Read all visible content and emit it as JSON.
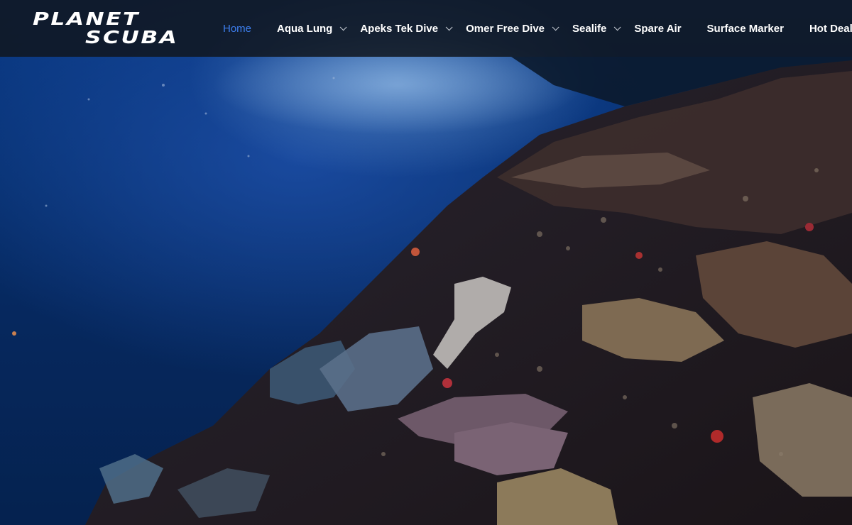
{
  "site": {
    "logo_line1": "PLANET",
    "logo_line2": "SCUBA"
  },
  "nav": {
    "items": [
      {
        "label": "Home",
        "active": true,
        "has_submenu": false
      },
      {
        "label": "Aqua Lung",
        "active": false,
        "has_submenu": true
      },
      {
        "label": "Apeks Tek Dive",
        "active": false,
        "has_submenu": true
      },
      {
        "label": "Omer Free Dive",
        "active": false,
        "has_submenu": true
      },
      {
        "label": "Sealife",
        "active": false,
        "has_submenu": true
      },
      {
        "label": "Spare Air",
        "active": false,
        "has_submenu": false
      },
      {
        "label": "Surface Marker",
        "active": false,
        "has_submenu": false
      },
      {
        "label": "Hot Deal",
        "active": false,
        "has_submenu": false
      }
    ]
  },
  "colors": {
    "header_bg": "#10161e",
    "nav_text": "#ffffff",
    "nav_active": "#3d7ff0",
    "water_deep": "#05224f",
    "water_light": "#2f6fc0"
  },
  "hero": {
    "icon": "underwater-coral-reef-photo"
  }
}
